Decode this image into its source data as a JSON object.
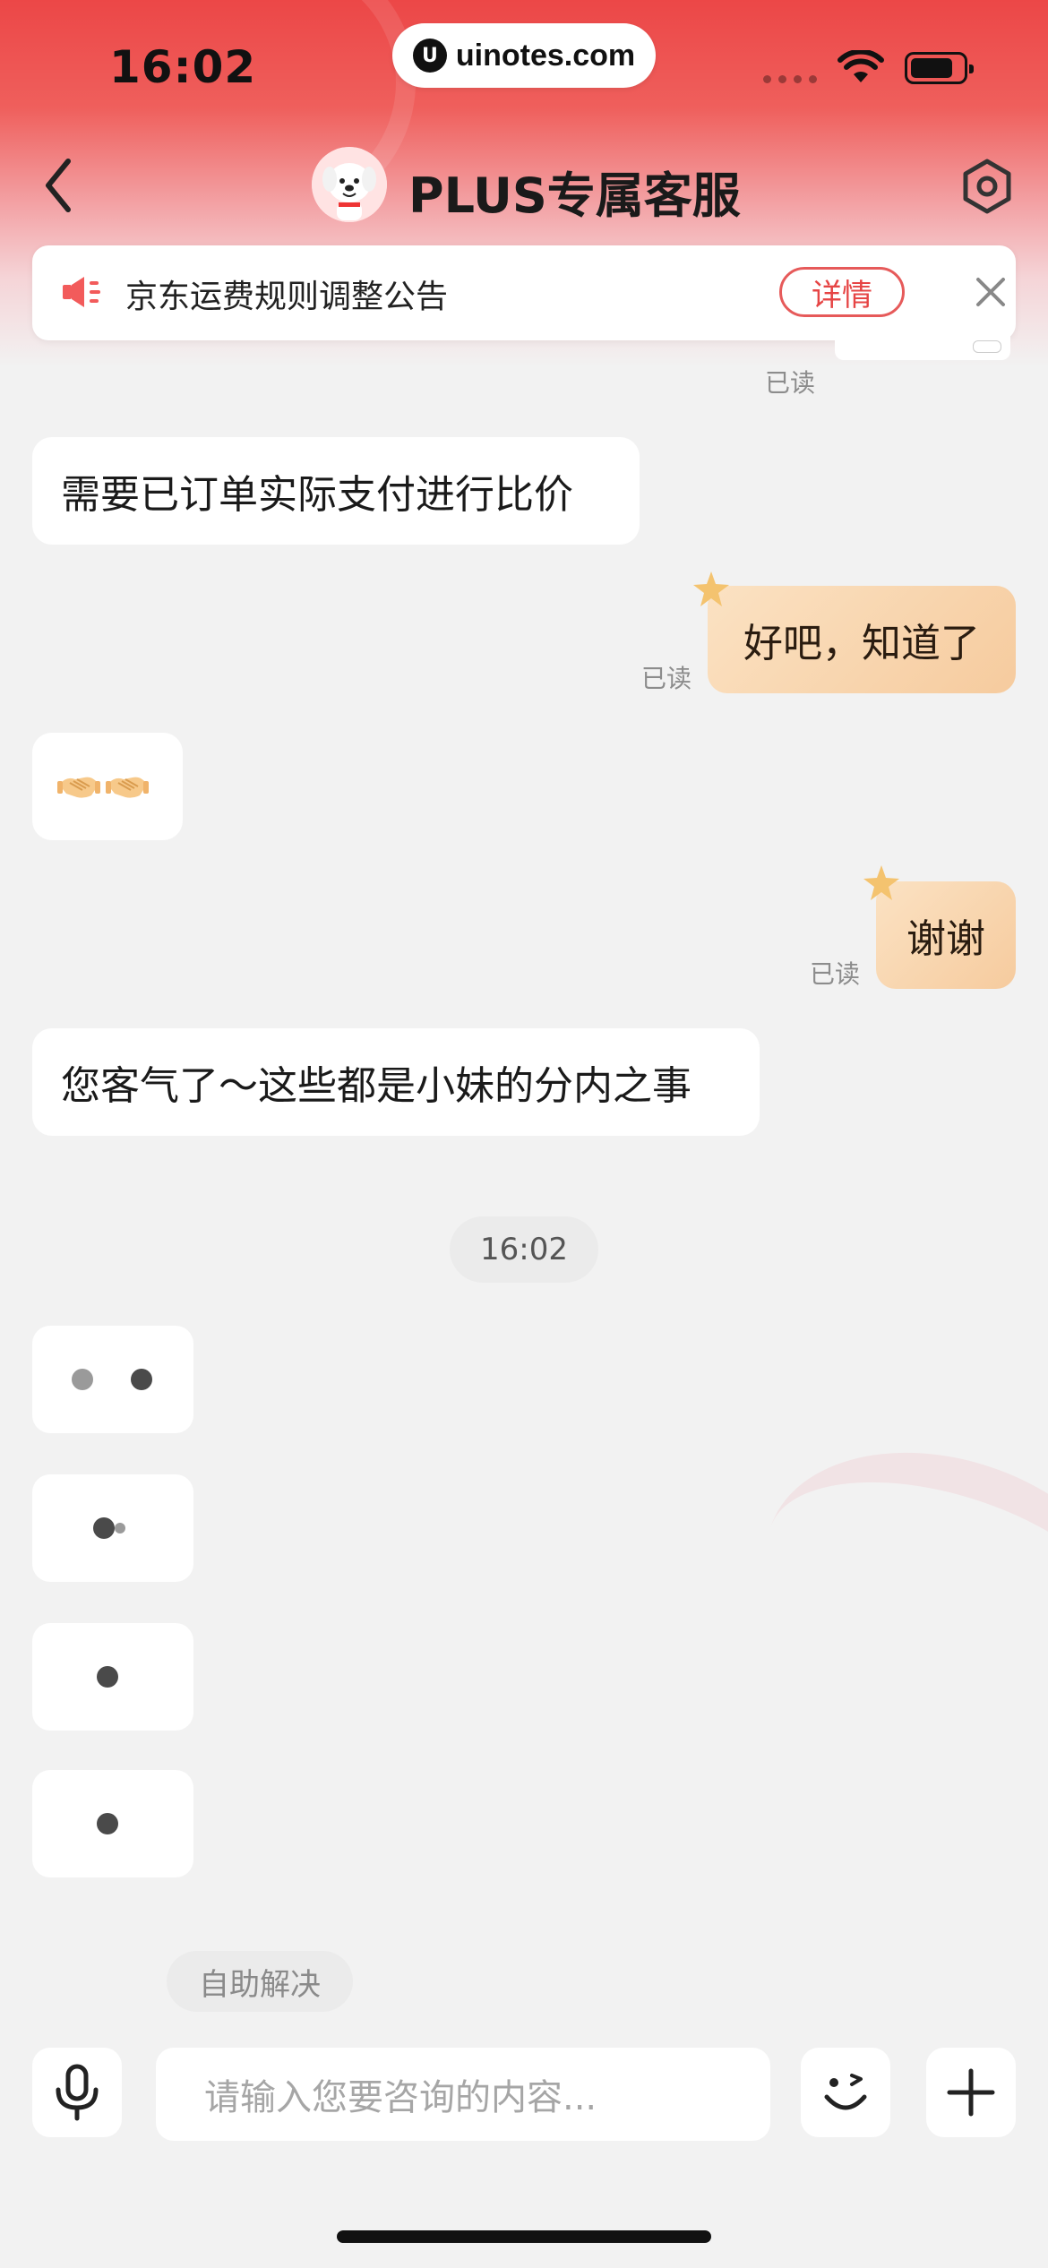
{
  "status_bar": {
    "time": "16:02",
    "url": "uinotes.com",
    "url_logo": "U"
  },
  "nav": {
    "title": "PLUS专属客服",
    "back_icon": "chevron-left-icon",
    "settings_icon": "hexagon-settings-icon"
  },
  "notice": {
    "text": "京东运费规则调整公告",
    "detail_label": "详情"
  },
  "messages": [
    {
      "side": "right",
      "read": "已读"
    },
    {
      "side": "left",
      "text": "需要已订单实际支付进行比价"
    },
    {
      "side": "right",
      "text": "好吧，知道了",
      "read": "已读"
    },
    {
      "side": "left",
      "emoji": "handshake-emoji x2"
    },
    {
      "side": "right",
      "text": "谢谢",
      "read": "已读"
    },
    {
      "side": "left",
      "text": "您客气了～这些都是小妹的分内之事"
    }
  ],
  "timestamp": "16:02",
  "self_help": "自助解决",
  "input": {
    "placeholder": "请输入您要咨询的内容..."
  },
  "colors": {
    "accent_red": "#e64545",
    "bubble_right": "#f6cb9e",
    "background": "#f2f2f2"
  }
}
